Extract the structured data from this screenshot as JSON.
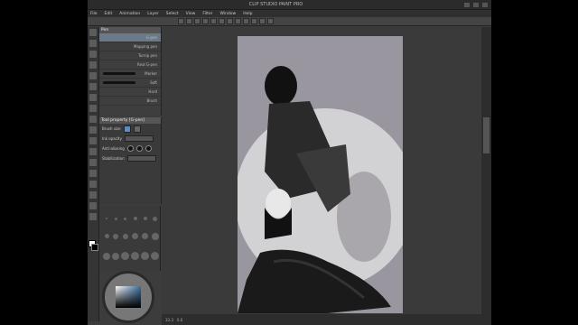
{
  "window": {
    "title": "CLIP STUDIO PAINT PRO"
  },
  "menubar": {
    "items": [
      "File",
      "Edit",
      "Animation",
      "Layer",
      "Select",
      "View",
      "Filter",
      "Window",
      "Help"
    ]
  },
  "subtool": {
    "title": "Pen",
    "brushes": [
      {
        "label": "G-pen"
      },
      {
        "label": "Mapping pen"
      },
      {
        "label": "Turnip pen"
      },
      {
        "label": "Real G-pen"
      },
      {
        "label": "Marker"
      },
      {
        "label": "Soft"
      },
      {
        "label": "Hard"
      },
      {
        "label": "Brush"
      }
    ]
  },
  "tool_property": {
    "title": "Tool property [G-pen]",
    "rows": [
      {
        "label": "Brush size"
      },
      {
        "label": "Ink opacity"
      },
      {
        "label": "Anti-aliasing"
      },
      {
        "label": "Stabilization"
      }
    ]
  },
  "statusbar": {
    "zoom": "33.3",
    "angle": "0.0"
  },
  "colors": {
    "accent": "#6a7a8a",
    "canvas": "#9a96a0",
    "workspace": "#3a3a3a"
  }
}
